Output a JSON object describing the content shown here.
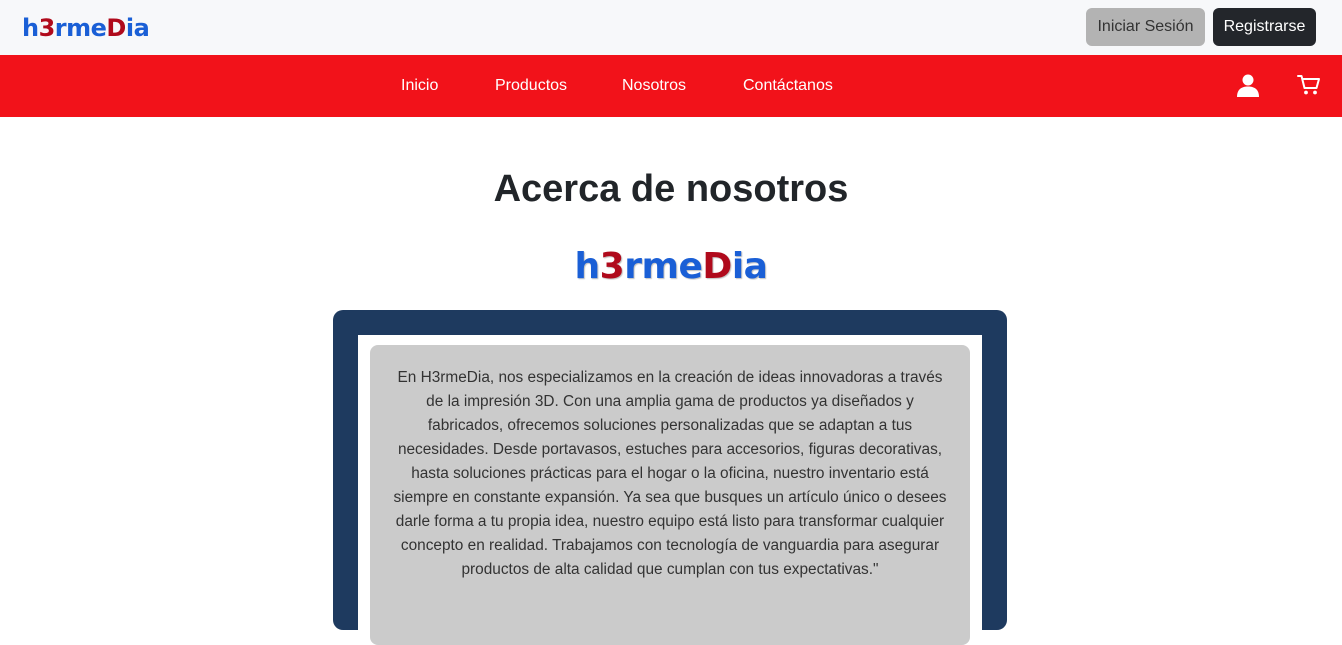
{
  "brand": {
    "logo_part1": "h",
    "logo_part2": "3",
    "logo_part3": "rme",
    "logo_part4": "D",
    "logo_part5": "ia"
  },
  "header": {
    "login_label": "Iniciar Sesión",
    "register_label": "Registrarse"
  },
  "nav": {
    "items": [
      {
        "label": "Inicio"
      },
      {
        "label": "Productos"
      },
      {
        "label": "Nosotros"
      },
      {
        "label": "Contáctanos"
      }
    ],
    "icons": [
      "user-icon",
      "cart-icon"
    ]
  },
  "about": {
    "title": "Acerca de nosotros",
    "text": "En H3rmeDia, nos especializamos en la creación de ideas innovadoras a través de la impresión 3D. Con una amplia gama de productos ya diseñados y fabricados, ofrecemos soluciones personalizadas que se adaptan a tus necesidades. Desde portavasos, estuches para accesorios, figuras decorativas, hasta soluciones prácticas para el hogar o la oficina, nuestro inventario está siempre en constante expansión. Ya sea que busques un artículo único o desees darle forma a tu propia idea, nuestro equipo está listo para transformar cualquier concepto en realidad. Trabajamos con tecnología de vanguardia para asegurar productos de alta calidad que cumplan con tus expectativas.\""
  },
  "colors": {
    "navbar": "#f2121a",
    "frame": "#1e3a5f",
    "card": "#cbcbcb",
    "logo_blue": "#1a5fd6",
    "logo_red": "#b00a1c"
  }
}
